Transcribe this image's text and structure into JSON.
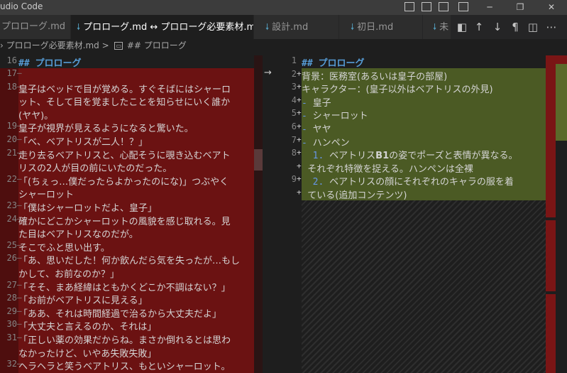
{
  "titlebar": {
    "title": "udio Code"
  },
  "tabs": [
    {
      "label": "プロローグ.md",
      "active": false
    },
    {
      "label": "プロローグ.md ↔ プロローグ必要素材.md",
      "active": true,
      "close": "✕"
    },
    {
      "label": "設計.md",
      "active": false
    },
    {
      "label": "初日.md",
      "active": false
    },
    {
      "label": "未",
      "active": false
    }
  ],
  "breadcrumb": {
    "file": "プロローグ必要素材.md",
    "separator": ">",
    "symbol": "## プロローグ"
  },
  "left": {
    "header": {
      "num": "16",
      "text": "## プロローグ"
    },
    "lines": [
      {
        "num": "17",
        "text": ""
      },
      {
        "num": "18",
        "text": "皇子はベッドで目が覚める。すぐそばにはシャーロ"
      },
      {
        "num": "",
        "text": "ット、そして目を覚ましたことを知らせにいく誰か"
      },
      {
        "num": "",
        "text": "(ヤヤ)。"
      },
      {
        "num": "19",
        "text": "皇子が視界が見えるようになると驚いた。"
      },
      {
        "num": "20",
        "text": "「べ、ベアトリスが二人！？」"
      },
      {
        "num": "21",
        "text": "走り去るベアトリスと、心配そうに覗き込むベアト"
      },
      {
        "num": "",
        "text": "リスの2人が目の前にいたのだった。"
      },
      {
        "num": "22",
        "text": "「(ちぇっ…僕だったらよかったのにな)」つぶやく"
      },
      {
        "num": "",
        "text": "シャーロット"
      },
      {
        "num": "23",
        "text": "「僕はシャーロットだよ、皇子」"
      },
      {
        "num": "24",
        "text": "確かにどこかシャーロットの風貌を感じ取れる。見"
      },
      {
        "num": "",
        "text": "た目はベアトリスなのだが。"
      },
      {
        "num": "25",
        "text": "そこでふと思い出す。"
      },
      {
        "num": "26",
        "text": "「あ、思いだした！何か飲んだら気を失ったが…もし"
      },
      {
        "num": "",
        "text": "かして、お前なのか？」"
      },
      {
        "num": "27",
        "text": "「そそ、まあ経緯はともかくどこか不調はない？」"
      },
      {
        "num": "28",
        "text": "「お前がベアトリスに見える」"
      },
      {
        "num": "29",
        "text": "「ああ、それは時間経過で治るから大丈夫だよ」"
      },
      {
        "num": "30",
        "text": "「大丈夫と言えるのか、それは」"
      },
      {
        "num": "31",
        "text": "「正しい薬の効果だからね。まさか倒れるとは思わ"
      },
      {
        "num": "",
        "text": "なかったけど、いやあ失敗失敗」"
      },
      {
        "num": "32",
        "text": "ヘラヘラと笑うベアトリス、もといシャーロット。"
      }
    ]
  },
  "right": {
    "arrow": "→",
    "lines": [
      {
        "num": "1",
        "mark": "",
        "parts": [
          {
            "t": "## プロローグ",
            "c": "heading"
          }
        ]
      },
      {
        "num": "2",
        "mark": "+",
        "parts": [
          {
            "t": "背景：医務室(あるいは皇子の部屋)",
            "c": ""
          }
        ]
      },
      {
        "num": "3",
        "mark": "+",
        "parts": [
          {
            "t": "キャラクター：(皇子以外はベアトリスの外見)",
            "c": ""
          }
        ]
      },
      {
        "num": "4",
        "mark": "+",
        "parts": [
          {
            "t": "- ",
            "c": "dash"
          },
          {
            "t": "皇子",
            "c": ""
          }
        ]
      },
      {
        "num": "5",
        "mark": "+",
        "parts": [
          {
            "t": "- ",
            "c": "dash"
          },
          {
            "t": "シャーロット",
            "c": ""
          }
        ]
      },
      {
        "num": "6",
        "mark": "+",
        "parts": [
          {
            "t": "- ",
            "c": "dash"
          },
          {
            "t": "ヤヤ",
            "c": ""
          }
        ]
      },
      {
        "num": "7",
        "mark": "+",
        "parts": [
          {
            "t": "- ",
            "c": "dash"
          },
          {
            "t": "ハンペン",
            "c": ""
          }
        ]
      },
      {
        "num": "8",
        "mark": "+",
        "parts": [
          {
            "t": "  1. ",
            "c": "num"
          },
          {
            "t": "ベアトリス",
            "c": ""
          },
          {
            "t": "B1",
            "c": "bold"
          },
          {
            "t": "の姿でポーズと表情が異なる。",
            "c": ""
          }
        ]
      },
      {
        "num": "",
        "mark": "+",
        "parts": [
          {
            "t": "  それぞれ特徴を捉える。ハンペンは全裸",
            "c": ""
          }
        ]
      },
      {
        "num": "9",
        "mark": "+",
        "parts": [
          {
            "t": "  2. ",
            "c": "num"
          },
          {
            "t": "ベアトリスの顔にそれぞれのキャラの服を着",
            "c": ""
          }
        ]
      },
      {
        "num": "",
        "mark": "+",
        "parts": [
          {
            "t": "  ている(追加コンテンツ)",
            "c": ""
          }
        ]
      }
    ]
  },
  "colors": {
    "deleted": "#6b1212",
    "inserted": "#4b5a24",
    "heading": "#569cd6",
    "list_marker": "#6796e6"
  }
}
